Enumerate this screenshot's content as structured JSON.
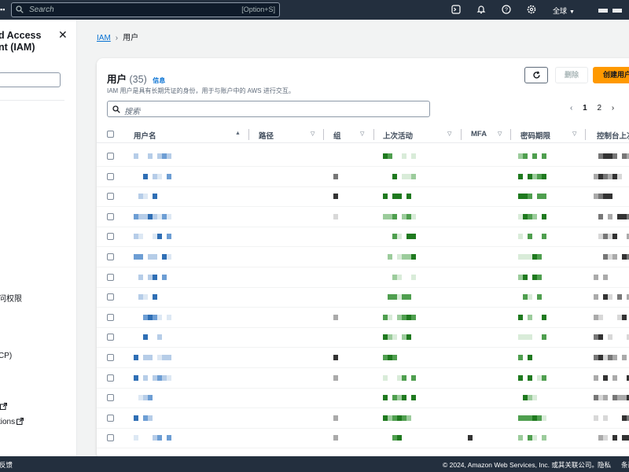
{
  "topbar": {
    "search_placeholder": "Search",
    "search_shortcut": "[Option+S]",
    "region": "全球"
  },
  "sidenav": {
    "title": "d Access\nnt (IAM)",
    "items": [
      {
        "label": "问权限",
        "external": false
      },
      {
        "label": "CP)",
        "external": false
      },
      {
        "label": "",
        "external": true
      },
      {
        "label": "tions",
        "external": true
      }
    ]
  },
  "breadcrumb": {
    "root": "IAM",
    "current": "用户"
  },
  "users_panel": {
    "title": "用户",
    "count": "(35)",
    "info": "信息",
    "description": "IAM 用户是具有长期凭证的身份，用于与账户中的 AWS 进行交互。",
    "delete_label": "删除",
    "create_label": "创建用户",
    "filter_placeholder": "搜索",
    "pages": [
      "1",
      "2"
    ],
    "prev_arrow": "‹",
    "next_arrow": "›"
  },
  "table": {
    "columns": [
      {
        "label": "用户名",
        "sort": "▲"
      },
      {
        "label": "路径",
        "sort": "▽"
      },
      {
        "label": "组",
        "sort": "▽"
      },
      {
        "label": "上次活动",
        "sort": "▽"
      },
      {
        "label": "MFA",
        "sort": "▽"
      },
      {
        "label": "密码期限",
        "sort": "▽"
      },
      {
        "label": "控制台上次",
        "sort": ""
      }
    ],
    "rows": 15
  },
  "footer": {
    "feedback": "反馈",
    "copyright": "© 2024, Amazon Web Services, Inc. 或其关联公司。",
    "privacy": "隐私",
    "terms": "条款"
  },
  "colors": {
    "topbar_bg": "#232f3e",
    "primary_button": "#ff9900",
    "link": "#0972d3"
  }
}
